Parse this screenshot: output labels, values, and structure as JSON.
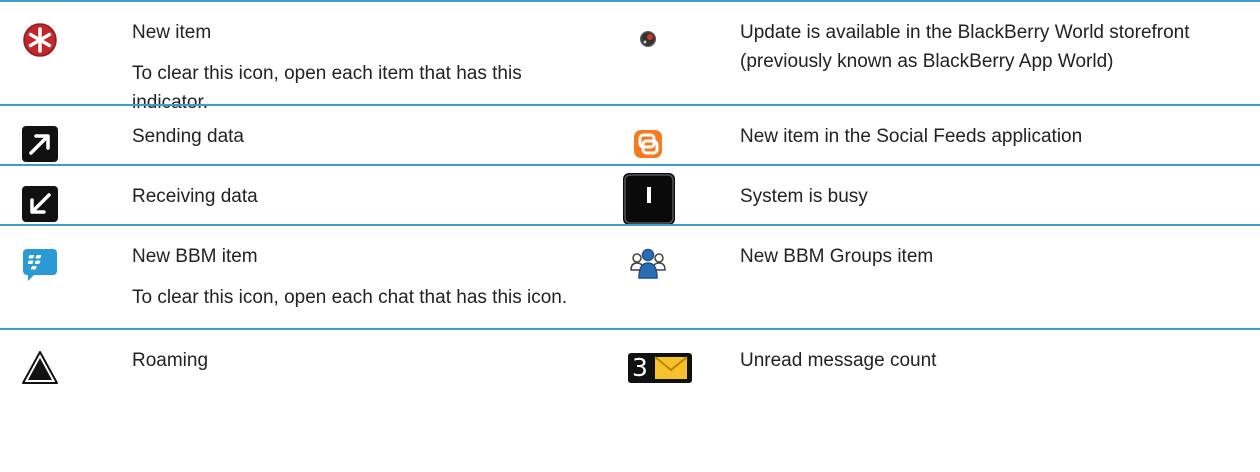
{
  "rows": [
    {
      "left": {
        "icon": "new-item-icon",
        "label": "New item",
        "note": "To clear this icon, open each item that has this indicator."
      },
      "right": {
        "icon": "update-available-icon",
        "label": "Update is available in the BlackBerry World storefront (previously known as BlackBerry App World)"
      }
    },
    {
      "left": {
        "icon": "sending-data-icon",
        "label": "Sending data"
      },
      "right": {
        "icon": "social-feeds-icon",
        "label": "New item in the Social Feeds application"
      }
    },
    {
      "left": {
        "icon": "receiving-data-icon",
        "label": "Receiving data"
      },
      "right": {
        "icon": "system-busy-icon",
        "label": "System is busy"
      }
    },
    {
      "left": {
        "icon": "bbm-icon",
        "label": "New BBM item",
        "note": "To clear this icon, open each chat that has this icon."
      },
      "right": {
        "icon": "bbm-groups-icon",
        "label": "New BBM Groups item"
      }
    },
    {
      "left": {
        "icon": "roaming-icon",
        "label": "Roaming"
      },
      "right": {
        "icon": "unread-message-count-icon",
        "label": "Unread message count",
        "count": "3"
      }
    }
  ],
  "colors": {
    "divider": "#3aa0c8",
    "new_item_red": "#c0272d",
    "social_orange": "#f47b20",
    "bbm_blue": "#2a9ad6",
    "envelope_yellow": "#f6c12b"
  }
}
